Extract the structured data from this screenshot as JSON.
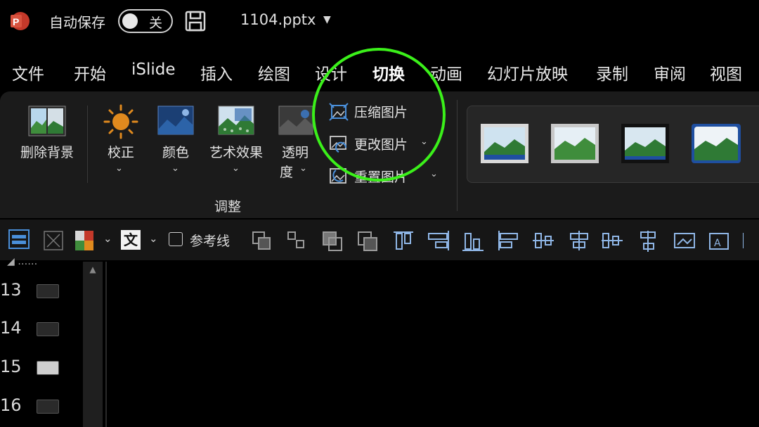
{
  "titlebar": {
    "autosave_label": "自动保存",
    "toggle_state": "关",
    "filename": "1104.pptx"
  },
  "tabs": [
    "文件",
    "开始",
    "iSlide",
    "插入",
    "绘图",
    "设计",
    "切换",
    "动画",
    "幻灯片放映",
    "录制",
    "审阅",
    "视图"
  ],
  "active_tab": "切换",
  "ribbon": {
    "remove_bg": "删除背景",
    "corrections": "校正",
    "color": "颜色",
    "artistic": "艺术效果",
    "transparency_1": "透明",
    "transparency_2": "度",
    "compress": "压缩图片",
    "change": "更改图片",
    "reset": "重置图片",
    "group_adjust": "调整"
  },
  "qat": {
    "wen": "文",
    "guides_label": "参考线"
  },
  "slides": [
    "13",
    "14",
    "15",
    "16"
  ],
  "colors": {
    "highlight": "#3bf01a",
    "accent_blue": "#4a8fd9",
    "logo": "#c4392a"
  }
}
